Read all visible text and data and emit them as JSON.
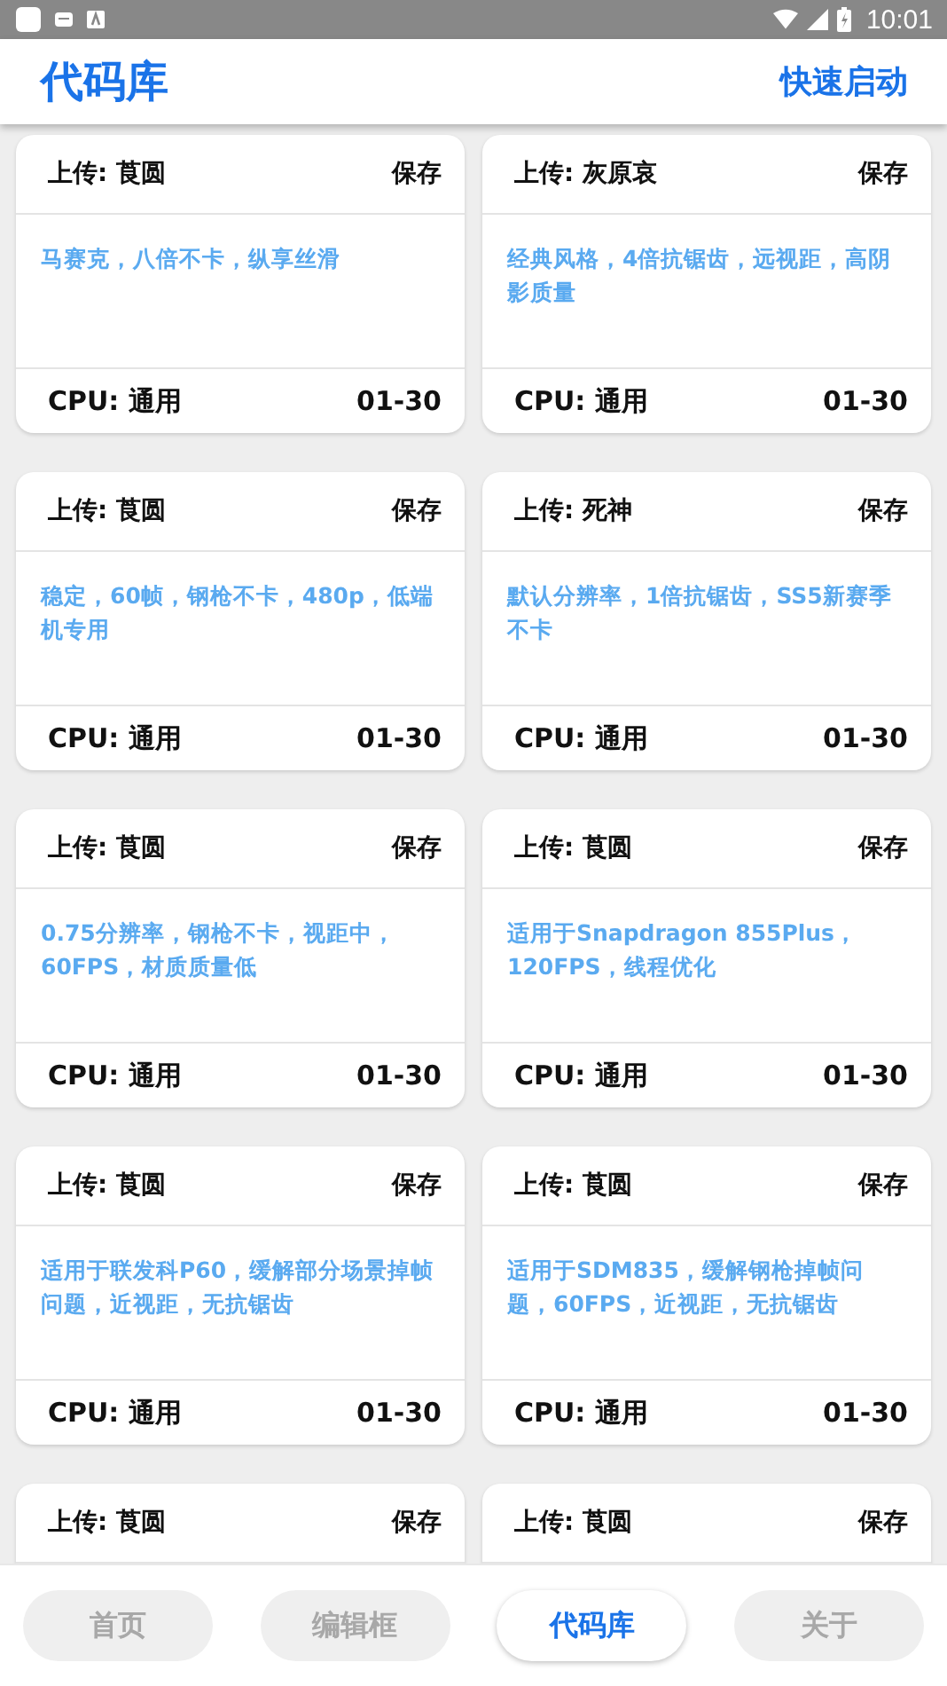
{
  "status_bar": {
    "time": "10:01"
  },
  "header": {
    "title": "代码库",
    "action": "快速启动"
  },
  "cards": [
    {
      "uploader": "上传: 莨圆",
      "save": "保存",
      "description": "马赛克，八倍不卡，纵享丝滑",
      "cpu": "CPU: 通用",
      "date": "01-30"
    },
    {
      "uploader": "上传: 灰原哀",
      "save": "保存",
      "description": "经典风格，4倍抗锯齿，远视距，高阴影质量",
      "cpu": "CPU: 通用",
      "date": "01-30"
    },
    {
      "uploader": "上传: 莨圆",
      "save": "保存",
      "description": "稳定，60帧，钢枪不卡，480p，低端机专用",
      "cpu": "CPU: 通用",
      "date": "01-30"
    },
    {
      "uploader": "上传: 死神",
      "save": "保存",
      "description": "默认分辨率，1倍抗锯齿，SS5新赛季不卡",
      "cpu": "CPU: 通用",
      "date": "01-30"
    },
    {
      "uploader": "上传: 莨圆",
      "save": "保存",
      "description": "0.75分辨率，钢枪不卡，视距中，60FPS，材质质量低",
      "cpu": "CPU: 通用",
      "date": "01-30"
    },
    {
      "uploader": "上传: 莨圆",
      "save": "保存",
      "description": "适用于Snapdragon 855Plus，120FPS，线程优化",
      "cpu": "CPU: 通用",
      "date": "01-30"
    },
    {
      "uploader": "上传: 莨圆",
      "save": "保存",
      "description": "适用于联发科P60，缓解部分场景掉帧问题，近视距，无抗锯齿",
      "cpu": "CPU: 通用",
      "date": "01-30"
    },
    {
      "uploader": "上传: 莨圆",
      "save": "保存",
      "description": "适用于SDM835，缓解钢枪掉帧问题，60FPS，近视距，无抗锯齿",
      "cpu": "CPU: 通用",
      "date": "01-30"
    },
    {
      "uploader": "上传: 莨圆",
      "save": "保存"
    },
    {
      "uploader": "上传: 莨圆",
      "save": "保存"
    }
  ],
  "bottom_nav": [
    {
      "label": "首页",
      "selected": false
    },
    {
      "label": "编辑框",
      "selected": false
    },
    {
      "label": "代码库",
      "selected": true
    },
    {
      "label": "关于",
      "selected": false
    }
  ]
}
